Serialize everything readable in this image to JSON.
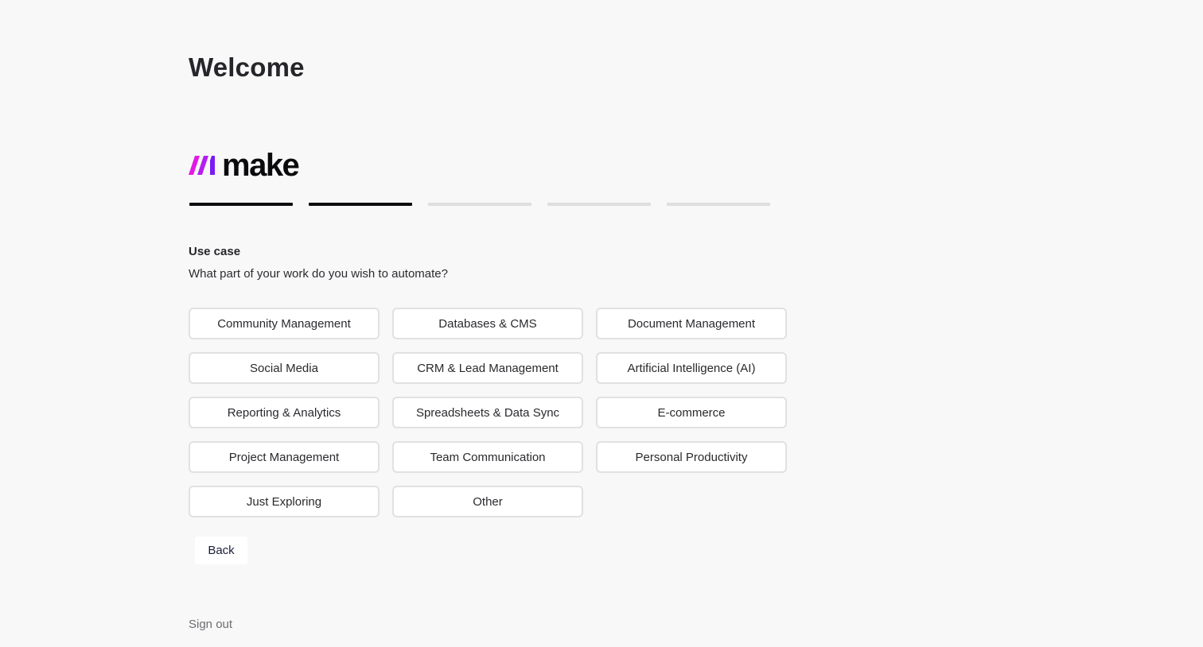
{
  "page": {
    "title": "Welcome"
  },
  "brand": {
    "name": "make",
    "logo_icon": "make-logo-icon",
    "logo_colors": [
      "#7a1cf4",
      "#b51ef0",
      "#e21ae6"
    ]
  },
  "progress": {
    "total_steps": 5,
    "completed_steps": 2,
    "completed_color": "#0d0d0f",
    "pending_color": "#dedede"
  },
  "use_case": {
    "title": "Use case",
    "question": "What part of your work do you wish to automate?",
    "options": [
      "Community Management",
      "Databases & CMS",
      "Document Management",
      "Social Media",
      "CRM & Lead Management",
      "Artificial Intelligence (AI)",
      "Reporting & Analytics",
      "Spreadsheets & Data Sync",
      "E-commerce",
      "Project Management",
      "Team Communication",
      "Personal Productivity",
      "Just Exploring",
      "Other"
    ]
  },
  "actions": {
    "back_label": "Back",
    "sign_out_label": "Sign out"
  }
}
